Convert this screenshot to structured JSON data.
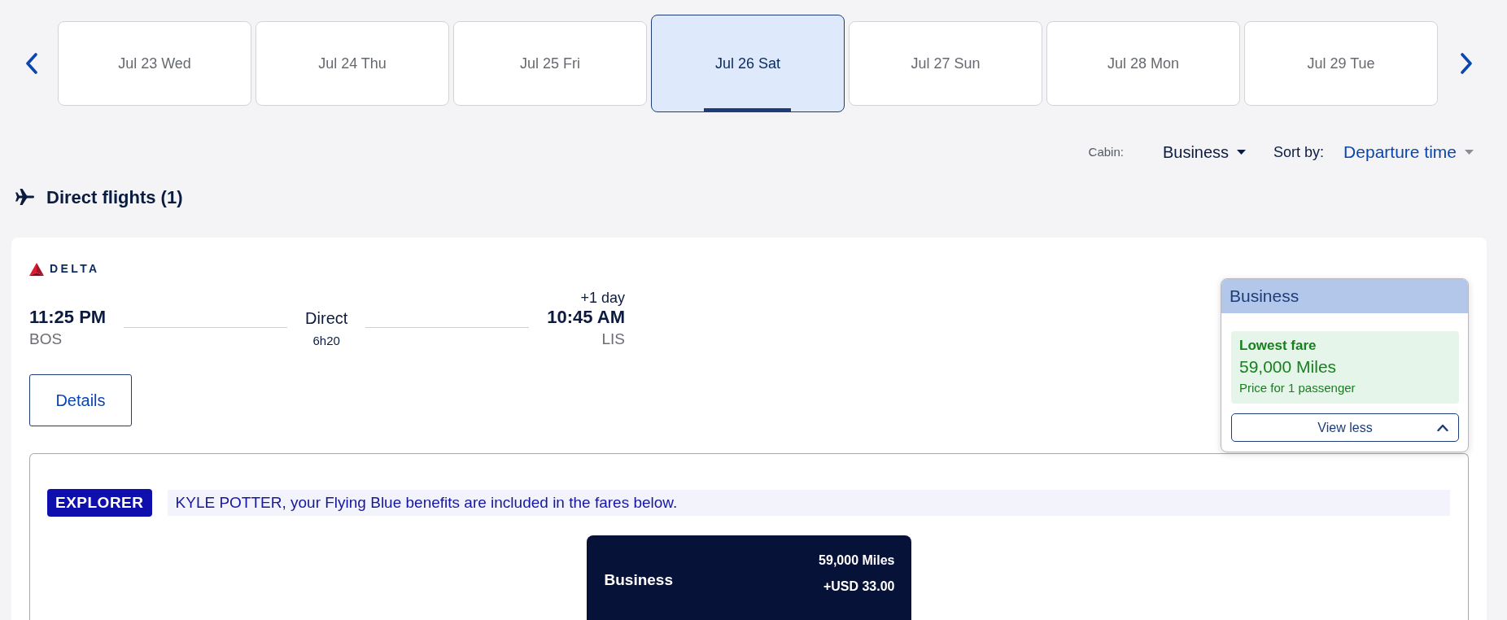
{
  "dates": [
    {
      "label": "Jul 23 Wed",
      "selected": false
    },
    {
      "label": "Jul 24 Thu",
      "selected": false
    },
    {
      "label": "Jul 25 Fri",
      "selected": false
    },
    {
      "label": "Jul 26 Sat",
      "selected": true
    },
    {
      "label": "Jul 27 Sun",
      "selected": false
    },
    {
      "label": "Jul 28 Mon",
      "selected": false
    },
    {
      "label": "Jul 29 Tue",
      "selected": false
    }
  ],
  "filters": [
    {
      "kind": "cabin",
      "label": "Cabin:",
      "value": "Business"
    },
    {
      "kind": "sort",
      "label": "Sort by:",
      "value": "Departure time"
    }
  ],
  "section": {
    "title": "Direct flights (1)"
  },
  "flight": {
    "airline": "DELTA",
    "departure": {
      "time": "11:25 PM",
      "airport": "BOS"
    },
    "stops": "Direct",
    "duration": "6h20",
    "arrival": {
      "day_offset": "+1 day",
      "time": "10:45 AM",
      "airport": "LIS"
    },
    "details_button": "Details"
  },
  "fare_popup": {
    "cabin": "Business",
    "badge": "Lowest fare",
    "price": "59,000 Miles",
    "note": "Price for 1 passenger",
    "toggle": "View less",
    "expanded": true
  },
  "benefits": {
    "tier": "EXPLORER",
    "message": "KYLE POTTER, your Flying Blue benefits are included in the fares below."
  },
  "fares": [
    {
      "cabin": "Business",
      "miles": "59,000 Miles",
      "cash": "+USD 33.00"
    }
  ]
}
